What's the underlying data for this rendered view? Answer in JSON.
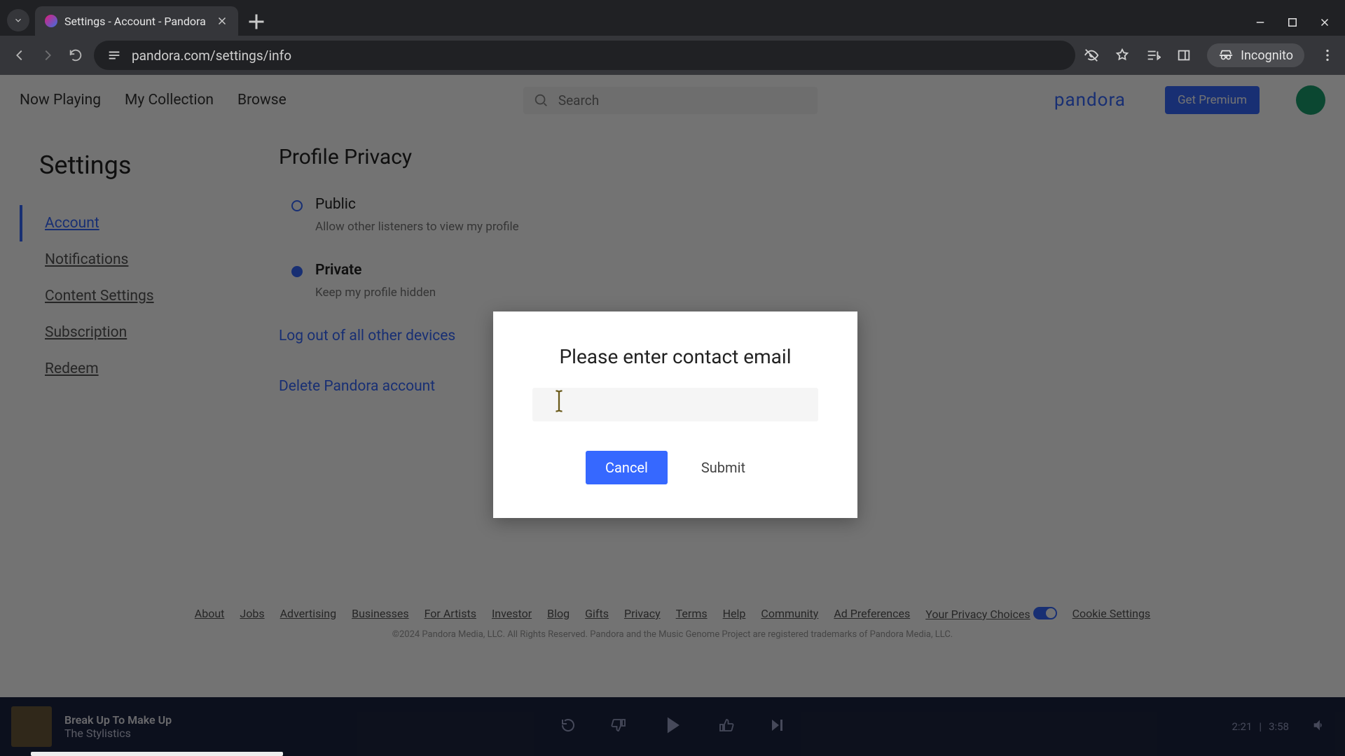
{
  "browser": {
    "tab_title": "Settings - Account - Pandora",
    "url": "pandora.com/settings/info",
    "incognito_label": "Incognito"
  },
  "nav": {
    "items": [
      "Now Playing",
      "My Collection",
      "Browse"
    ],
    "search_placeholder": "Search",
    "brand": "pandora",
    "cta": "Get Premium"
  },
  "sidebar": {
    "title": "Settings",
    "items": [
      {
        "label": "Account",
        "active": true
      },
      {
        "label": "Notifications",
        "active": false
      },
      {
        "label": "Content Settings",
        "active": false
      },
      {
        "label": "Subscription",
        "active": false
      },
      {
        "label": "Redeem",
        "active": false
      }
    ]
  },
  "main": {
    "heading": "Profile Privacy",
    "options": [
      {
        "title": "Public",
        "desc": "Allow other listeners to view my profile",
        "selected": false
      },
      {
        "title": "Private",
        "desc": "Keep my profile hidden",
        "selected": true
      }
    ],
    "logout_all": "Log out of all other devices",
    "delete": "Delete Pandora account"
  },
  "footer": {
    "links": [
      "About",
      "Jobs",
      "Advertising",
      "Businesses",
      "For Artists",
      "Investor",
      "Blog",
      "Gifts",
      "Privacy",
      "Terms",
      "Help",
      "Community",
      "Ad Preferences",
      "Your Privacy Choices",
      "Cookie Settings"
    ],
    "copyright": "©2024 Pandora Media, LLC. All Rights Reserved. Pandora and the Music Genome Project are registered trademarks of Pandora Media, LLC."
  },
  "player": {
    "song": "Break Up To Make Up",
    "artist": "The Stylistics",
    "elapsed": "2:21",
    "divider": "|",
    "total": "3:58"
  },
  "modal": {
    "title": "Please enter contact email",
    "value": "",
    "cancel": "Cancel",
    "submit": "Submit"
  }
}
